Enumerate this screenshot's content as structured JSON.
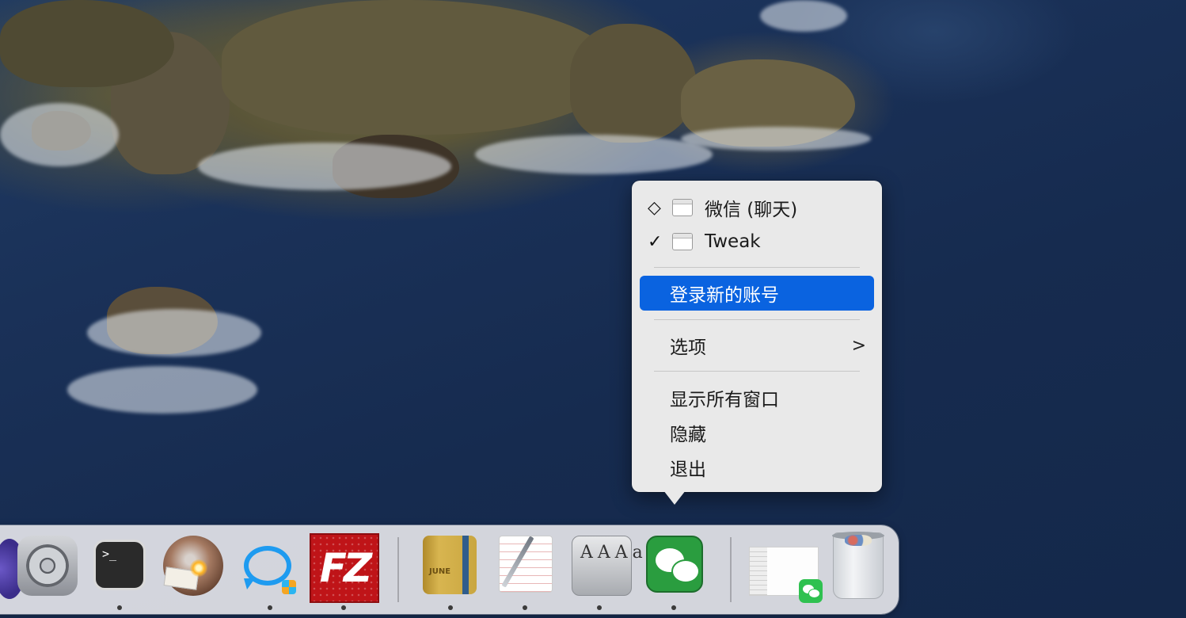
{
  "context_menu": {
    "windows": [
      {
        "mark": "◇",
        "label": "微信 (聊天)"
      },
      {
        "mark": "✓",
        "label": "Tweak"
      }
    ],
    "login_new_account": "登录新的账号",
    "options": "选项",
    "options_chevron": ">",
    "show_all_windows": "显示所有窗口",
    "hide": "隐藏",
    "quit": "退出",
    "highlight_color": "#0a63e0"
  },
  "dock": {
    "items": [
      {
        "name": "system-preferences",
        "icon": "gear-icon",
        "running": true
      },
      {
        "name": "terminal",
        "icon": "terminal-icon",
        "glyph": ">_",
        "running": true
      },
      {
        "name": "fetch",
        "icon": "fetch-icon",
        "running": true
      },
      {
        "name": "qq-mail",
        "icon": "chat-bubble-icon",
        "running": true
      },
      {
        "name": "filezilla",
        "icon": "filezilla-icon",
        "glyph": "FZ",
        "running": true
      },
      {
        "name": "notebook",
        "icon": "notebook-icon",
        "glyph": "JUNE",
        "running": true
      },
      {
        "name": "textedit",
        "icon": "textedit-icon",
        "running": true
      },
      {
        "name": "font-book",
        "icon": "font-book-icon",
        "glyph": "AAAa",
        "running": true
      },
      {
        "name": "wechat",
        "icon": "wechat-icon",
        "running": true
      },
      {
        "name": "wechat-minimized-window",
        "icon": "window-thumbnail-icon",
        "running": false
      },
      {
        "name": "trash",
        "icon": "trash-icon",
        "running": false
      }
    ]
  }
}
